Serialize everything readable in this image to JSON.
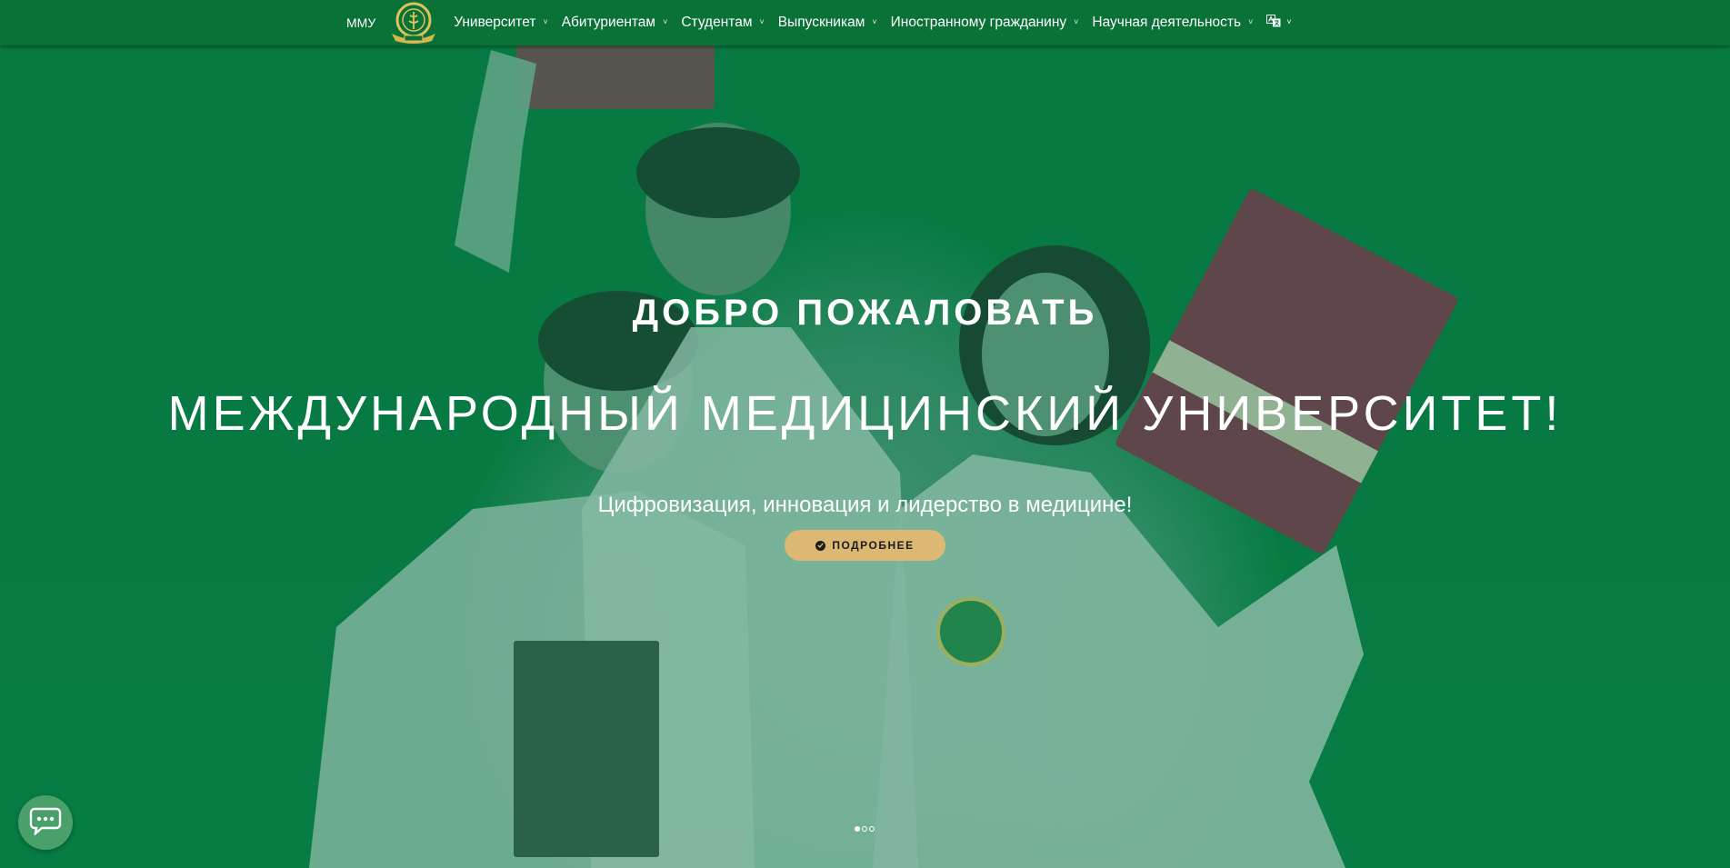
{
  "navbar": {
    "brand": "ММУ",
    "logo_icon": "university-emblem-icon",
    "items": [
      {
        "label": "Университет"
      },
      {
        "label": "Абитуриентам"
      },
      {
        "label": "Студентам"
      },
      {
        "label": "Выпускникам"
      },
      {
        "label": "Иностранному гражданину"
      },
      {
        "label": "Научная деятельность"
      }
    ],
    "caret": "˅",
    "language_icon": "language-icon"
  },
  "hero": {
    "welcome": "ДОБРО ПОЖАЛОВАТЬ",
    "university_name": "МЕЖДУНАРОДНЫЙ МЕДИЦИНСКИЙ УНИВЕРСИТЕТ!",
    "tagline": "Цифровизация, инновация и лидерство в медицине!",
    "button_label": "ПОДРОБНЕЕ",
    "button_icon": "check-circle-icon"
  },
  "carousel": {
    "slide_count": 3,
    "active_index": 0
  },
  "chat": {
    "icon": "chat-icon"
  },
  "colors": {
    "navbar": "#0a7236",
    "hero_tint": "#0a7a43",
    "button": "#dcb872",
    "chat_button": "#4aa06a"
  }
}
